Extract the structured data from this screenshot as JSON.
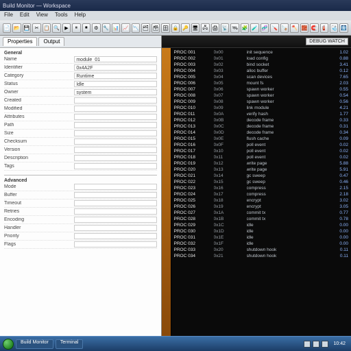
{
  "window": {
    "title": "Build Monitor — Workspace"
  },
  "menu": {
    "file": "File",
    "edit": "Edit",
    "view": "View",
    "tools": "Tools",
    "help": "Help"
  },
  "right_badge": "DEBUG WATCH",
  "tabs": [
    {
      "label": "Properties",
      "active": true
    },
    {
      "label": "Output"
    }
  ],
  "form": {
    "section_a": "General",
    "section_b": "Advanced",
    "rows_a": [
      {
        "label": "Name",
        "value": "module_01"
      },
      {
        "label": "Identifier",
        "value": "0x4A2F"
      },
      {
        "label": "Category",
        "value": "Runtime"
      },
      {
        "label": "Status",
        "value": "Idle"
      },
      {
        "label": "Owner",
        "value": "system"
      },
      {
        "label": "Created",
        "value": ""
      },
      {
        "label": "Modified",
        "value": ""
      },
      {
        "label": "Attributes",
        "value": ""
      },
      {
        "label": "Path",
        "value": ""
      },
      {
        "label": "Size",
        "value": ""
      },
      {
        "label": "Checksum",
        "value": ""
      },
      {
        "label": "Version",
        "value": ""
      },
      {
        "label": "Description",
        "value": ""
      },
      {
        "label": "Tags",
        "value": ""
      }
    ],
    "rows_b": [
      {
        "label": "Mode",
        "value": ""
      },
      {
        "label": "Buffer",
        "value": ""
      },
      {
        "label": "Timeout",
        "value": ""
      },
      {
        "label": "Retries",
        "value": ""
      },
      {
        "label": "Encoding",
        "value": ""
      },
      {
        "label": "Handler",
        "value": ""
      },
      {
        "label": "Priority",
        "value": ""
      },
      {
        "label": "Flags",
        "value": ""
      }
    ]
  },
  "console": [
    {
      "c1": "PROC 001",
      "c2": "0x00",
      "c3": "init sequence",
      "c4": "1.02"
    },
    {
      "c1": "PROC 002",
      "c2": "0x01",
      "c3": "load config",
      "c4": "0.88"
    },
    {
      "c1": "PROC 003",
      "c2": "0x02",
      "c3": "bind socket",
      "c4": "3.41"
    },
    {
      "c1": "PROC 004",
      "c2": "0x03",
      "c3": "alloc buffer",
      "c4": "0.12"
    },
    {
      "c1": "PROC 005",
      "c2": "0x04",
      "c3": "scan devices",
      "c4": "7.65"
    },
    {
      "c1": "PROC 006",
      "c2": "0x05",
      "c3": "mount fs",
      "c4": "2.03"
    },
    {
      "c1": "PROC 007",
      "c2": "0x06",
      "c3": "spawn worker",
      "c4": "0.55"
    },
    {
      "c1": "PROC 008",
      "c2": "0x07",
      "c3": "spawn worker",
      "c4": "0.54"
    },
    {
      "c1": "PROC 009",
      "c2": "0x08",
      "c3": "spawn worker",
      "c4": "0.56"
    },
    {
      "c1": "PROC 010",
      "c2": "0x09",
      "c3": "link module",
      "c4": "4.21"
    },
    {
      "c1": "PROC 011",
      "c2": "0x0A",
      "c3": "verify hash",
      "c4": "1.77"
    },
    {
      "c1": "PROC 012",
      "c2": "0x0B",
      "c3": "decode frame",
      "c4": "0.33"
    },
    {
      "c1": "PROC 013",
      "c2": "0x0C",
      "c3": "decode frame",
      "c4": "0.31"
    },
    {
      "c1": "PROC 014",
      "c2": "0x0D",
      "c3": "decode frame",
      "c4": "0.34"
    },
    {
      "c1": "PROC 015",
      "c2": "0x0E",
      "c3": "flush cache",
      "c4": "0.09"
    },
    {
      "c1": "PROC 016",
      "c2": "0x0F",
      "c3": "poll event",
      "c4": "0.02"
    },
    {
      "c1": "PROC 017",
      "c2": "0x10",
      "c3": "poll event",
      "c4": "0.02"
    },
    {
      "c1": "PROC 018",
      "c2": "0x11",
      "c3": "poll event",
      "c4": "0.02"
    },
    {
      "c1": "PROC 019",
      "c2": "0x12",
      "c3": "write page",
      "c4": "5.88"
    },
    {
      "c1": "PROC 020",
      "c2": "0x13",
      "c3": "write page",
      "c4": "5.91"
    },
    {
      "c1": "PROC 021",
      "c2": "0x14",
      "c3": "gc sweep",
      "c4": "0.47"
    },
    {
      "c1": "PROC 022",
      "c2": "0x15",
      "c3": "gc sweep",
      "c4": "0.46"
    },
    {
      "c1": "PROC 023",
      "c2": "0x16",
      "c3": "compress",
      "c4": "2.15"
    },
    {
      "c1": "PROC 024",
      "c2": "0x17",
      "c3": "compress",
      "c4": "2.18"
    },
    {
      "c1": "PROC 025",
      "c2": "0x18",
      "c3": "encrypt",
      "c4": "3.02"
    },
    {
      "c1": "PROC 026",
      "c2": "0x19",
      "c3": "encrypt",
      "c4": "3.05"
    },
    {
      "c1": "PROC 027",
      "c2": "0x1A",
      "c3": "commit tx",
      "c4": "0.77"
    },
    {
      "c1": "PROC 028",
      "c2": "0x1B",
      "c3": "commit tx",
      "c4": "0.78"
    },
    {
      "c1": "PROC 029",
      "c2": "0x1C",
      "c3": "idle",
      "c4": "0.00"
    },
    {
      "c1": "PROC 030",
      "c2": "0x1D",
      "c3": "idle",
      "c4": "0.00"
    },
    {
      "c1": "PROC 031",
      "c2": "0x1E",
      "c3": "idle",
      "c4": "0.00"
    },
    {
      "c1": "PROC 032",
      "c2": "0x1F",
      "c3": "idle",
      "c4": "0.00"
    },
    {
      "c1": "PROC 033",
      "c2": "0x20",
      "c3": "shutdown hook",
      "c4": "0.11"
    },
    {
      "c1": "PROC 034",
      "c2": "0x21",
      "c3": "shutdown hook",
      "c4": "0.11"
    }
  ],
  "toolbar_icons": [
    "📄",
    "📂",
    "💾",
    "✂",
    "📋",
    "🔍",
    "▶",
    "⏸",
    "⏹",
    "⚙",
    "🔧",
    "📊",
    "📈",
    "📉",
    "🗂",
    "🗃",
    "🗄",
    "🔒",
    "🔑",
    "🖥",
    "🖧",
    "🖨",
    "📡",
    "🛰",
    "🧩",
    "🧪",
    "🧬",
    "🪛",
    "🪚",
    "🪓",
    "🧱",
    "🧲",
    "🧯",
    "🩺",
    "🩻"
  ],
  "taskbar": {
    "buttons": [
      "Build Monitor",
      "Terminal"
    ],
    "clock": "10:42"
  }
}
